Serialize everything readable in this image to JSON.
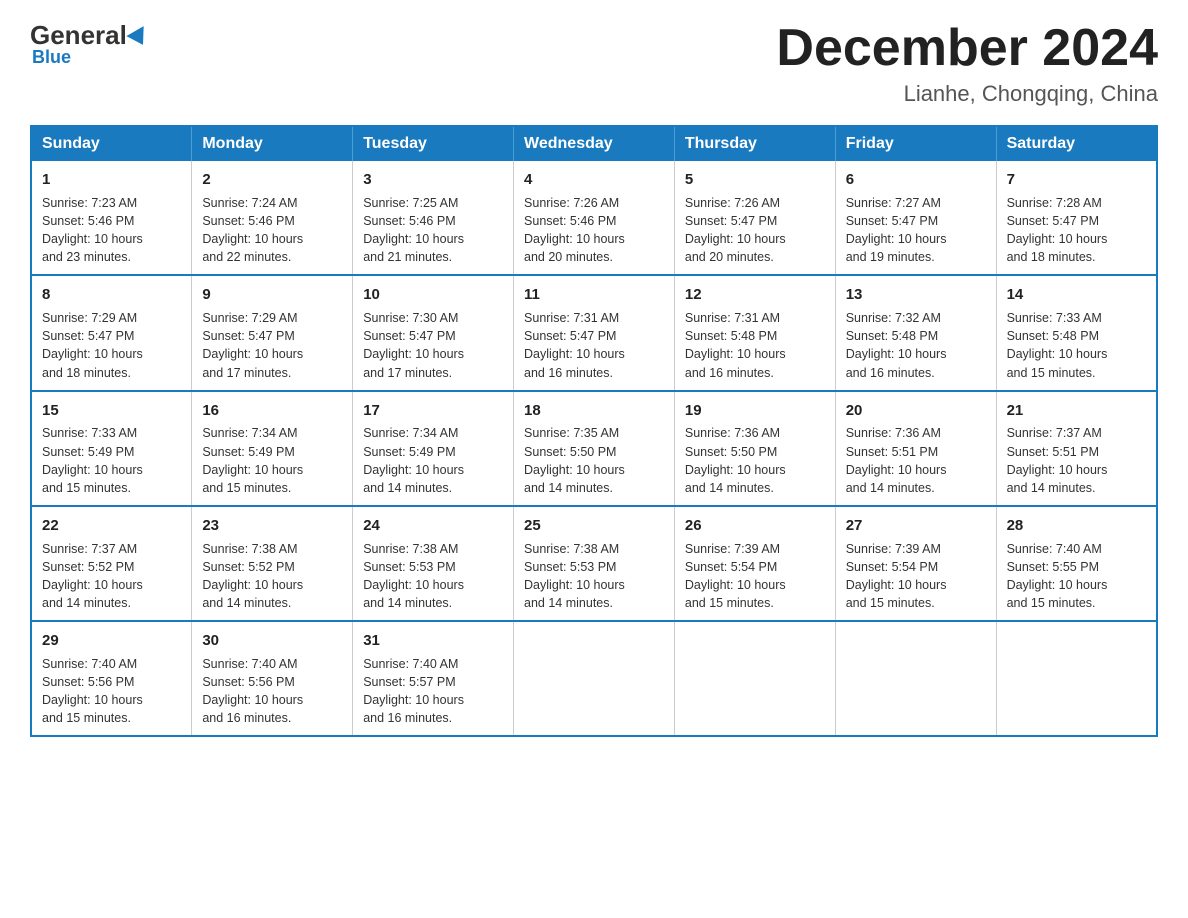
{
  "header": {
    "logo_general": "General",
    "logo_blue": "Blue",
    "title": "December 2024",
    "location": "Lianhe, Chongqing, China"
  },
  "days_of_week": [
    "Sunday",
    "Monday",
    "Tuesday",
    "Wednesday",
    "Thursday",
    "Friday",
    "Saturday"
  ],
  "weeks": [
    [
      {
        "day": "1",
        "info": "Sunrise: 7:23 AM\nSunset: 5:46 PM\nDaylight: 10 hours\nand 23 minutes."
      },
      {
        "day": "2",
        "info": "Sunrise: 7:24 AM\nSunset: 5:46 PM\nDaylight: 10 hours\nand 22 minutes."
      },
      {
        "day": "3",
        "info": "Sunrise: 7:25 AM\nSunset: 5:46 PM\nDaylight: 10 hours\nand 21 minutes."
      },
      {
        "day": "4",
        "info": "Sunrise: 7:26 AM\nSunset: 5:46 PM\nDaylight: 10 hours\nand 20 minutes."
      },
      {
        "day": "5",
        "info": "Sunrise: 7:26 AM\nSunset: 5:47 PM\nDaylight: 10 hours\nand 20 minutes."
      },
      {
        "day": "6",
        "info": "Sunrise: 7:27 AM\nSunset: 5:47 PM\nDaylight: 10 hours\nand 19 minutes."
      },
      {
        "day": "7",
        "info": "Sunrise: 7:28 AM\nSunset: 5:47 PM\nDaylight: 10 hours\nand 18 minutes."
      }
    ],
    [
      {
        "day": "8",
        "info": "Sunrise: 7:29 AM\nSunset: 5:47 PM\nDaylight: 10 hours\nand 18 minutes."
      },
      {
        "day": "9",
        "info": "Sunrise: 7:29 AM\nSunset: 5:47 PM\nDaylight: 10 hours\nand 17 minutes."
      },
      {
        "day": "10",
        "info": "Sunrise: 7:30 AM\nSunset: 5:47 PM\nDaylight: 10 hours\nand 17 minutes."
      },
      {
        "day": "11",
        "info": "Sunrise: 7:31 AM\nSunset: 5:47 PM\nDaylight: 10 hours\nand 16 minutes."
      },
      {
        "day": "12",
        "info": "Sunrise: 7:31 AM\nSunset: 5:48 PM\nDaylight: 10 hours\nand 16 minutes."
      },
      {
        "day": "13",
        "info": "Sunrise: 7:32 AM\nSunset: 5:48 PM\nDaylight: 10 hours\nand 16 minutes."
      },
      {
        "day": "14",
        "info": "Sunrise: 7:33 AM\nSunset: 5:48 PM\nDaylight: 10 hours\nand 15 minutes."
      }
    ],
    [
      {
        "day": "15",
        "info": "Sunrise: 7:33 AM\nSunset: 5:49 PM\nDaylight: 10 hours\nand 15 minutes."
      },
      {
        "day": "16",
        "info": "Sunrise: 7:34 AM\nSunset: 5:49 PM\nDaylight: 10 hours\nand 15 minutes."
      },
      {
        "day": "17",
        "info": "Sunrise: 7:34 AM\nSunset: 5:49 PM\nDaylight: 10 hours\nand 14 minutes."
      },
      {
        "day": "18",
        "info": "Sunrise: 7:35 AM\nSunset: 5:50 PM\nDaylight: 10 hours\nand 14 minutes."
      },
      {
        "day": "19",
        "info": "Sunrise: 7:36 AM\nSunset: 5:50 PM\nDaylight: 10 hours\nand 14 minutes."
      },
      {
        "day": "20",
        "info": "Sunrise: 7:36 AM\nSunset: 5:51 PM\nDaylight: 10 hours\nand 14 minutes."
      },
      {
        "day": "21",
        "info": "Sunrise: 7:37 AM\nSunset: 5:51 PM\nDaylight: 10 hours\nand 14 minutes."
      }
    ],
    [
      {
        "day": "22",
        "info": "Sunrise: 7:37 AM\nSunset: 5:52 PM\nDaylight: 10 hours\nand 14 minutes."
      },
      {
        "day": "23",
        "info": "Sunrise: 7:38 AM\nSunset: 5:52 PM\nDaylight: 10 hours\nand 14 minutes."
      },
      {
        "day": "24",
        "info": "Sunrise: 7:38 AM\nSunset: 5:53 PM\nDaylight: 10 hours\nand 14 minutes."
      },
      {
        "day": "25",
        "info": "Sunrise: 7:38 AM\nSunset: 5:53 PM\nDaylight: 10 hours\nand 14 minutes."
      },
      {
        "day": "26",
        "info": "Sunrise: 7:39 AM\nSunset: 5:54 PM\nDaylight: 10 hours\nand 15 minutes."
      },
      {
        "day": "27",
        "info": "Sunrise: 7:39 AM\nSunset: 5:54 PM\nDaylight: 10 hours\nand 15 minutes."
      },
      {
        "day": "28",
        "info": "Sunrise: 7:40 AM\nSunset: 5:55 PM\nDaylight: 10 hours\nand 15 minutes."
      }
    ],
    [
      {
        "day": "29",
        "info": "Sunrise: 7:40 AM\nSunset: 5:56 PM\nDaylight: 10 hours\nand 15 minutes."
      },
      {
        "day": "30",
        "info": "Sunrise: 7:40 AM\nSunset: 5:56 PM\nDaylight: 10 hours\nand 16 minutes."
      },
      {
        "day": "31",
        "info": "Sunrise: 7:40 AM\nSunset: 5:57 PM\nDaylight: 10 hours\nand 16 minutes."
      },
      null,
      null,
      null,
      null
    ]
  ]
}
